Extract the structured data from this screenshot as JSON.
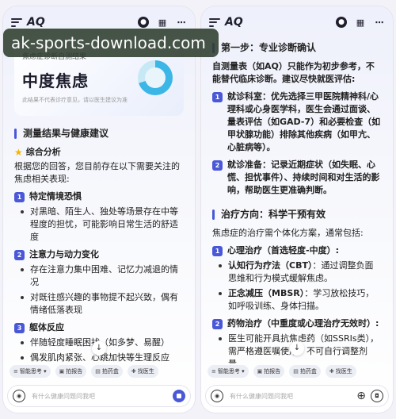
{
  "watermark": "ak-sports-download.com",
  "left": {
    "app_title": "AQ",
    "card": {
      "label": "焦虑症诊断自测结果",
      "title": "中度焦虑",
      "note": "此结果不代表诊疗意见，请以医生建议为准"
    },
    "section_title": "测量结果与健康建议",
    "summary_title": "综合分析",
    "summary_text": "根据您的回答，您目前存在以下需要关注的焦虑相关表现:",
    "items": [
      {
        "num": "1",
        "title": "特定情境恐惧",
        "bullets": [
          "对黑暗、陌生人、独处等场景存在中等程度的担忧，可能影响日常生活的舒适度"
        ]
      },
      {
        "num": "2",
        "title": "注意力与动力变化",
        "bullets": [
          "存在注意力集中困难、记忆力减退的情况",
          "对既往感兴趣的事物提不起兴致，偶有情绪低落表现"
        ]
      },
      {
        "num": "3",
        "title": "躯体反应",
        "bullets": [
          "伴随轻度睡眠困扰（如多梦、易醒）",
          "偶发肌肉紧张、心跳加快等生理反应"
        ]
      }
    ],
    "chips": [
      {
        "icon": "≡",
        "label": "智能思考 ▾"
      },
      {
        "icon": "▣",
        "label": "拍报告"
      },
      {
        "icon": "▤",
        "label": "拍药盒"
      },
      {
        "icon": "✚",
        "label": "找医生"
      }
    ],
    "input_placeholder": "有什么健康问题问我吧"
  },
  "right": {
    "app_title": "AQ",
    "step1_title": "第一步：专业诊断确认",
    "step1_text": "自测量表（如AQ）只能作为初步参考，不能替代临床诊断。建议尽快就医评估:",
    "step1_items": [
      {
        "num": "1",
        "text": "就诊科室：优先选择三甲医院精神科/心理科或心身医学科，医生会通过面谈、量表评估（如GAD-7）和必要检查（如甲状腺功能）排除其他疾病（如甲亢、心脏病等）。"
      },
      {
        "num": "2",
        "text": "就诊准备：记录近期症状（如失眠、心慌、担忧事件）、持续时间和对生活的影响，帮助医生更准确判断。"
      }
    ],
    "treat_title": "治疗方向：科学干预有效",
    "treat_text": "焦虑症的治疗需个体化方案，通常包括:",
    "treat_items": [
      {
        "num": "1",
        "title": "心理治疗（首选轻度-中度）:",
        "bullets": [
          {
            "bold": "认知行为疗法（CBT）",
            "rest": "：通过调整负面思维和行为模式缓解焦虑。"
          },
          {
            "bold": "正念减压（MBSR）",
            "rest": "：学习放松技巧，如呼吸训练、身体扫描。"
          }
        ]
      },
      {
        "num": "2",
        "title": "药物治疗（中重度或心理治疗无效时）:",
        "bullets": [
          {
            "bold": "",
            "rest": "医生可能开具抗焦虑药（如SSRIs类），需严格遵医嘱使用，不可自行调整剂量。"
          }
        ]
      }
    ],
    "chips": [
      {
        "icon": "≡",
        "label": "智能思考 ▾"
      },
      {
        "icon": "▣",
        "label": "拍报告"
      },
      {
        "icon": "▤",
        "label": "拍药盒"
      },
      {
        "icon": "✚",
        "label": "找医生"
      }
    ],
    "input_placeholder": "有什么健康问题问我吧"
  }
}
